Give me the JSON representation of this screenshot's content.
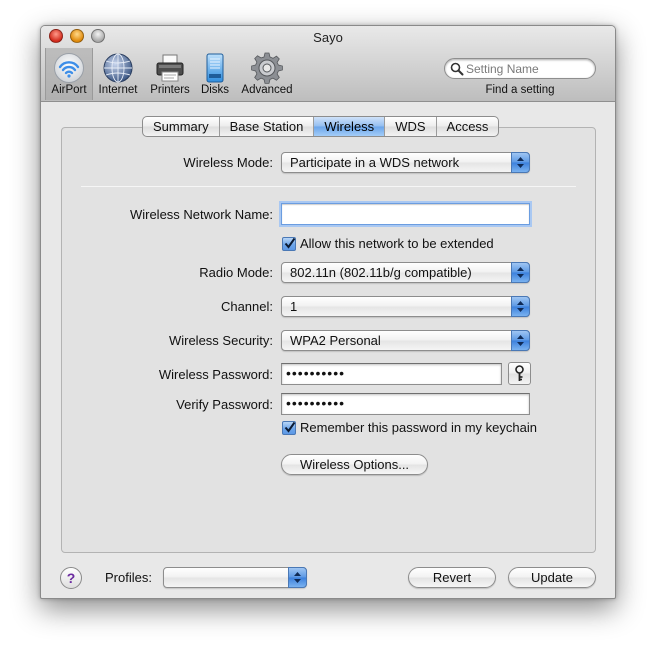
{
  "window": {
    "title": "Sayo"
  },
  "toolbar": {
    "items": [
      {
        "label": "AirPort",
        "icon": "airport-icon",
        "selected": true
      },
      {
        "label": "Internet",
        "icon": "internet-globe-icon",
        "selected": false
      },
      {
        "label": "Printers",
        "icon": "printer-icon",
        "selected": false
      },
      {
        "label": "Disks",
        "icon": "disk-icon",
        "selected": false
      },
      {
        "label": "Advanced",
        "icon": "gear-icon",
        "selected": false
      }
    ],
    "search": {
      "placeholder": "Setting Name",
      "caption": "Find a setting"
    }
  },
  "tabs": [
    {
      "label": "Summary",
      "active": false
    },
    {
      "label": "Base Station",
      "active": false
    },
    {
      "label": "Wireless",
      "active": true
    },
    {
      "label": "WDS",
      "active": false
    },
    {
      "label": "Access",
      "active": false
    }
  ],
  "form": {
    "wireless_mode": {
      "label": "Wireless Mode:",
      "value": "Participate in a WDS network"
    },
    "network_name": {
      "label": "Wireless Network Name:",
      "value": ""
    },
    "allow_extended": {
      "label": "Allow this network to be extended",
      "checked": true
    },
    "radio_mode": {
      "label": "Radio Mode:",
      "value": "802.11n (802.11b/g compatible)"
    },
    "channel": {
      "label": "Channel:",
      "value": "1"
    },
    "security": {
      "label": "Wireless Security:",
      "value": "WPA2 Personal"
    },
    "password": {
      "label": "Wireless Password:",
      "value": "••••••••••"
    },
    "verify_password": {
      "label": "Verify Password:",
      "value": "••••••••••"
    },
    "remember_keychain": {
      "label": "Remember this password in my keychain",
      "checked": true
    },
    "options_button": "Wireless Options..."
  },
  "footer": {
    "help_symbol": "?",
    "profiles_label": "Profiles:",
    "profiles_value": "",
    "revert_label": "Revert",
    "update_label": "Update"
  },
  "colors": {
    "accent": "#5a97e4",
    "window_bg": "#e8e8e8",
    "help_purple": "#6b2aa0"
  }
}
